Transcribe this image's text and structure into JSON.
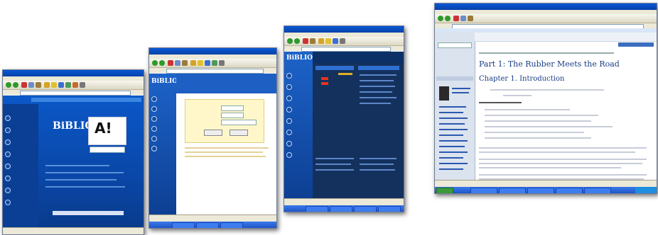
{
  "brand": "BiBLIO",
  "win1": {
    "ad_text": "A!",
    "nav_items": [
      "",
      "",
      "",
      "",
      "",
      "",
      "",
      ""
    ]
  },
  "win4": {
    "title": "Part 1: The Rubber Meets the Road",
    "chapter": "Chapter 1. Introduction"
  },
  "colors": {
    "xp_title": "#0a58d6",
    "biblio_blue": "#0a3f95",
    "biblio_dark": "#14315e",
    "taskbar": "#245edb"
  }
}
